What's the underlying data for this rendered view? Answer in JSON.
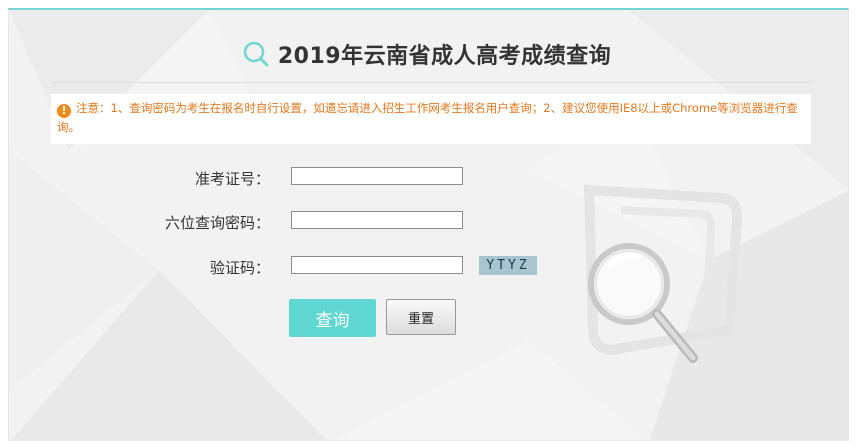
{
  "header": {
    "title": "2019年云南省成人高考成绩查询",
    "icon": "search-icon",
    "accent_color": "#5fd6d2"
  },
  "notice": {
    "icon": "warning-icon",
    "text": "注意：1、查询密码为考生在报名时自行设置，如遗忘请进入招生工作网考生报名用户查询；2、建议您使用IE8以上或Chrome等浏览器进行查询。",
    "color": "#e8761b"
  },
  "form": {
    "exam_number_label": "准考证号：",
    "exam_number_value": "",
    "password_label": "六位查询密码：",
    "password_value": "",
    "captcha_label": "验证码：",
    "captcha_value": "",
    "captcha_code": "YTYZ"
  },
  "buttons": {
    "query_label": "查询",
    "reset_label": "重置"
  },
  "decoration": {
    "icon": "magnifier-document-icon"
  }
}
